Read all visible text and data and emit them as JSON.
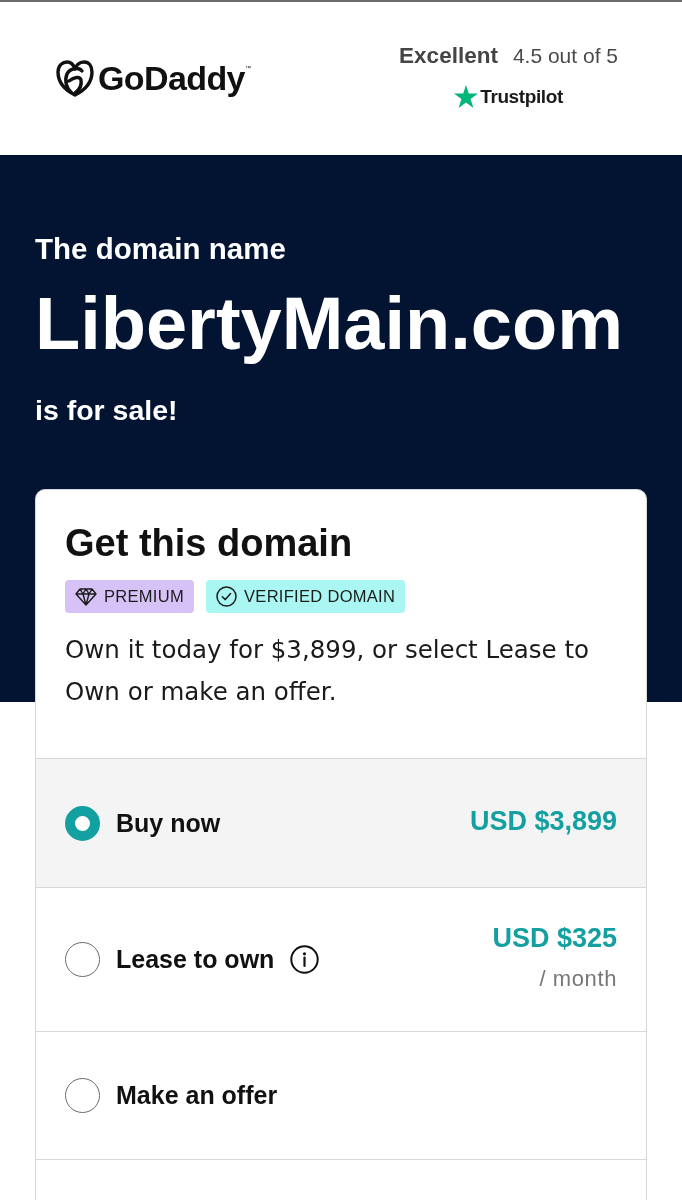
{
  "header": {
    "logo": {
      "text": "GoDaddy$^{™}$"
    },
    "rating": {
      "label": "Excellent",
      "score": "4.5 out of 5",
      "provider": "Trustpilot"
    }
  },
  "hero": {
    "intro": "The domain name",
    "domain": "LibertyMain.com",
    "outro": "is for sale!"
  },
  "card": {
    "title": "Get this domain",
    "badges": [
      {
        "kind": "premium",
        "label": "PREMIUM"
      },
      {
        "kind": "verified",
        "label": "VERIFIED DOMAIN"
      }
    ],
    "description": "Own it today for $3,899, or select Lease to Own or make an offer.",
    "options": [
      {
        "label": "Buy now",
        "selected": true,
        "info": false,
        "price": "USD $3,899"
      },
      {
        "label": "Lease to own",
        "selected": false,
        "info": true,
        "price": "USD $325",
        "price_note": "/ month"
      },
      {
        "label": "Make an offer",
        "selected": false,
        "info": false
      }
    ]
  }
}
